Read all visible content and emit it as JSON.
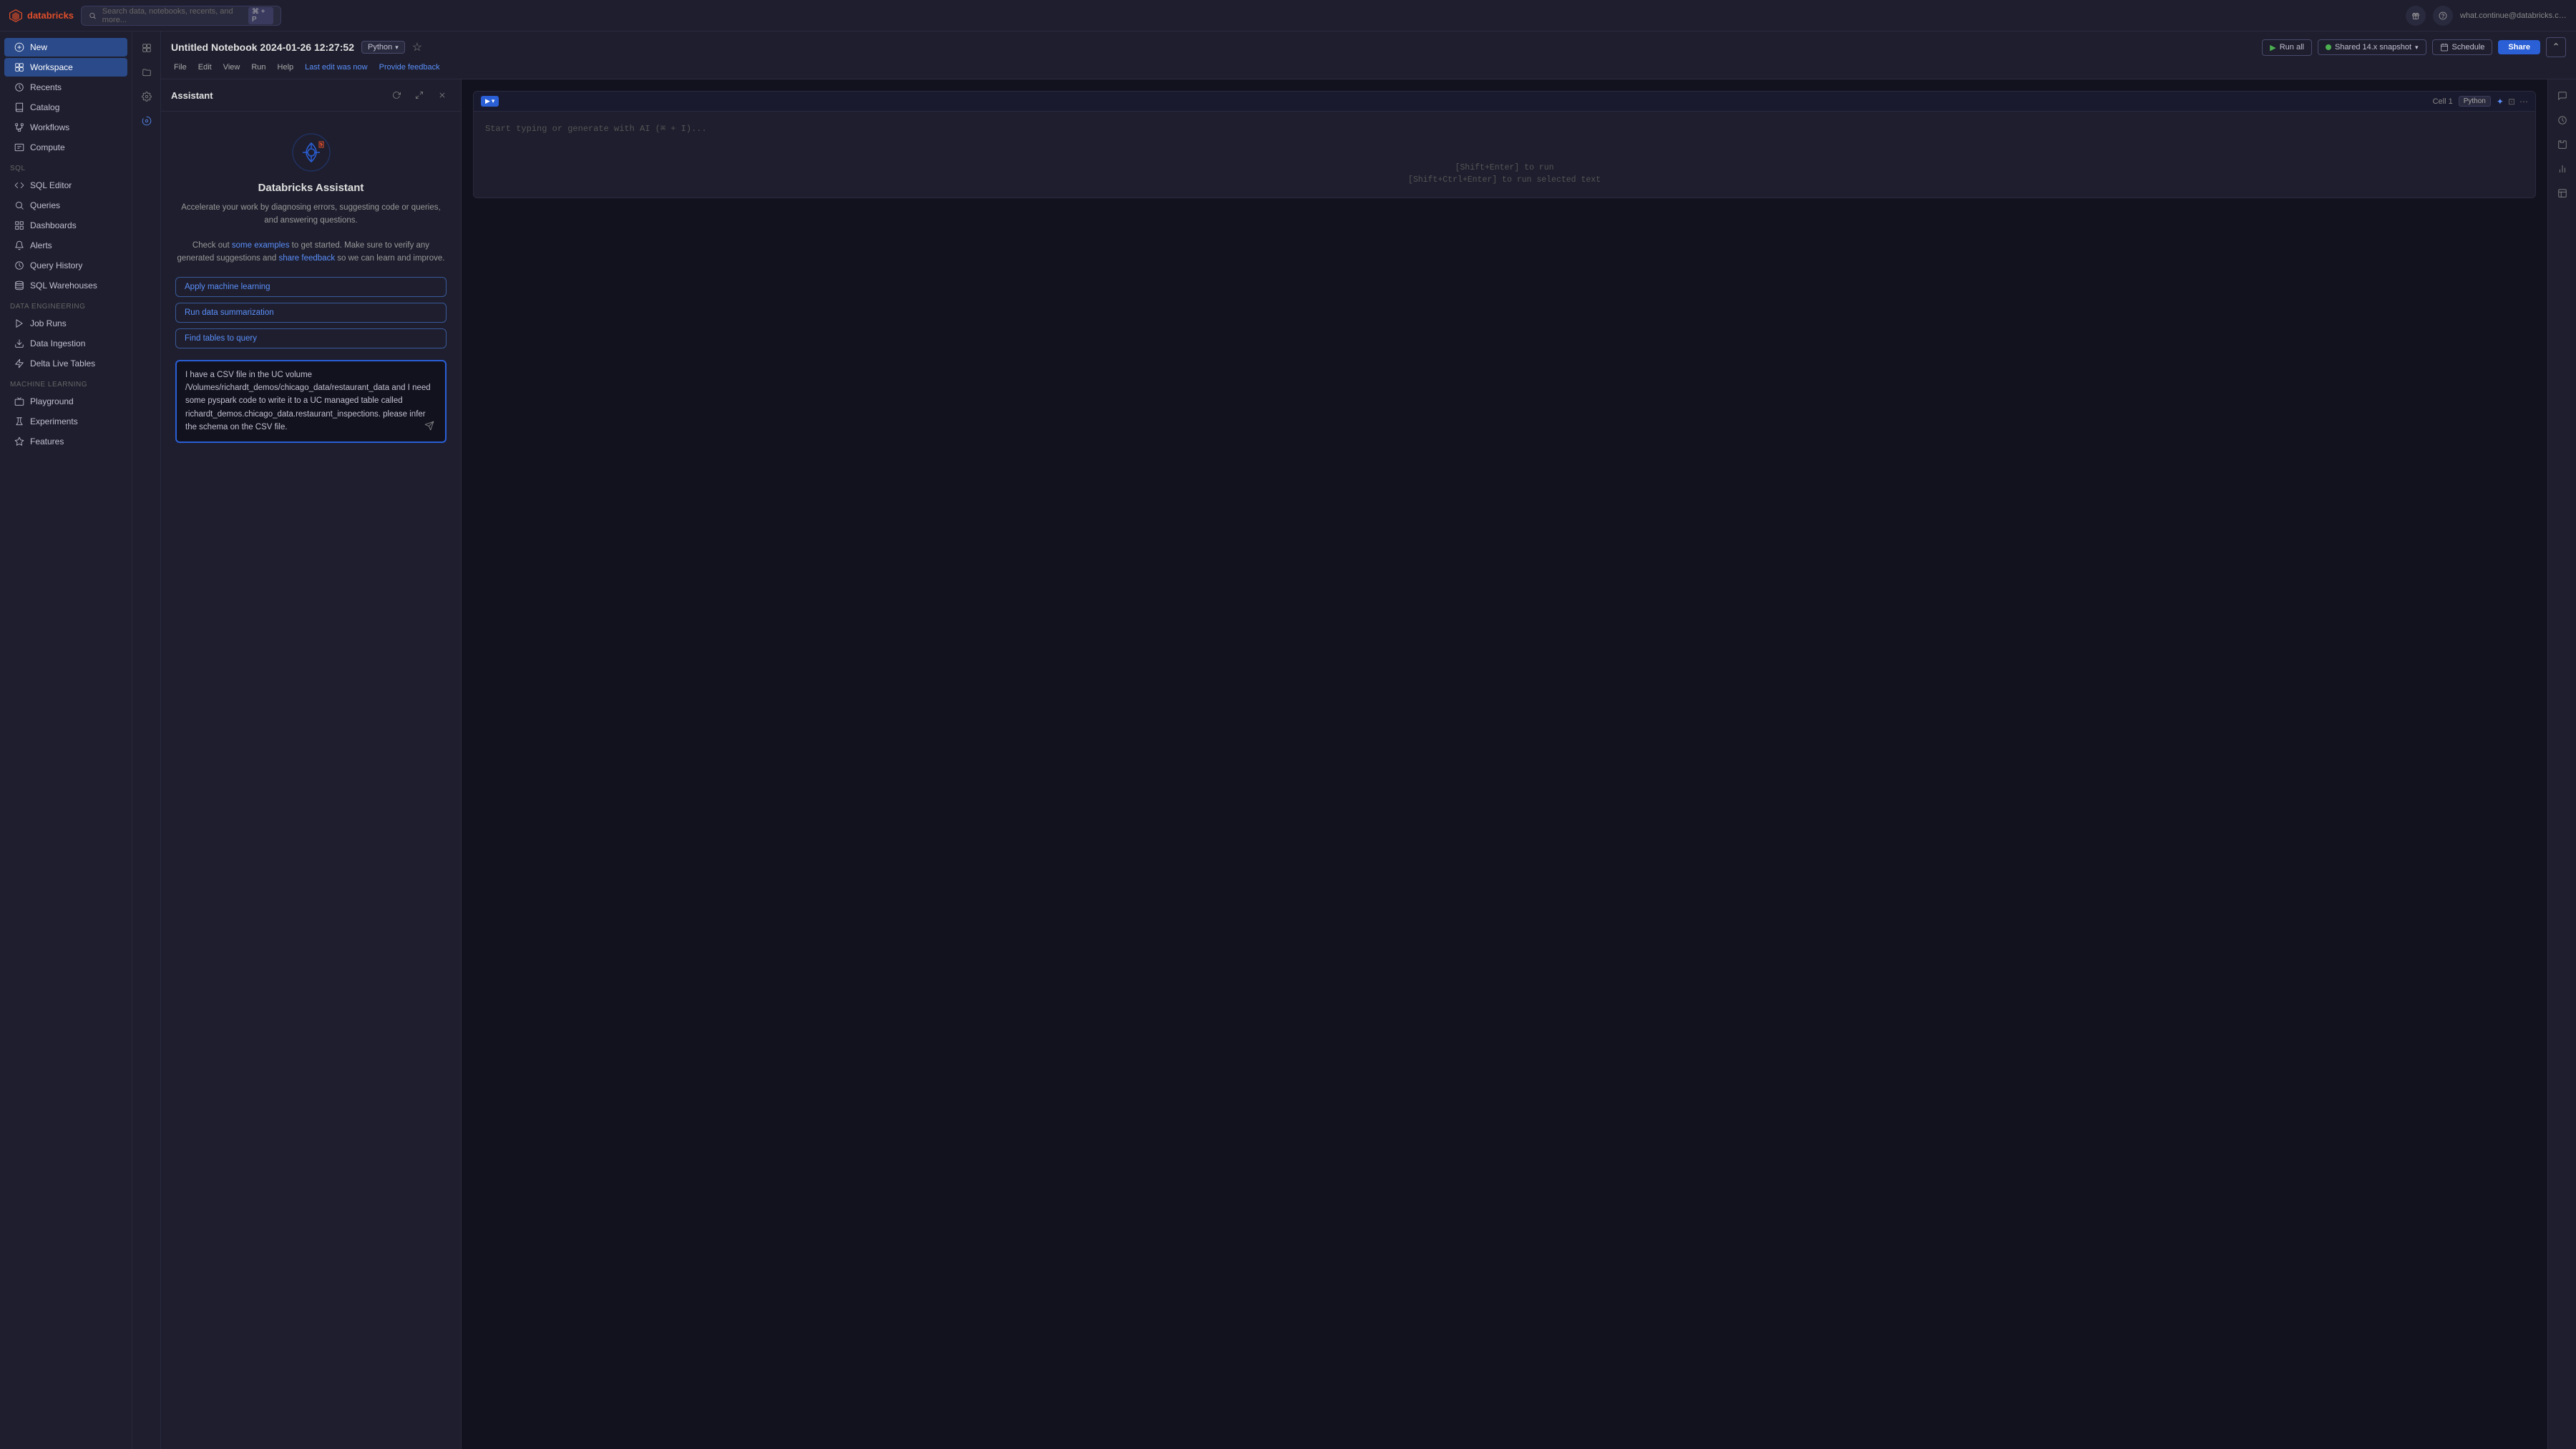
{
  "app": {
    "logo_text": "databricks"
  },
  "topbar": {
    "search_placeholder": "Search data, notebooks, recents, and more...",
    "search_shortcut": "⌘ + P",
    "user_info": "what.continue@databricks.co...."
  },
  "sidebar": {
    "new_label": "New",
    "items": [
      {
        "id": "workspace",
        "label": "Workspace",
        "active": true
      },
      {
        "id": "recents",
        "label": "Recents",
        "active": false
      },
      {
        "id": "catalog",
        "label": "Catalog",
        "active": false
      },
      {
        "id": "workflows",
        "label": "Workflows",
        "active": false
      },
      {
        "id": "compute",
        "label": "Compute",
        "active": false
      }
    ],
    "sql_section": "SQL",
    "sql_items": [
      {
        "id": "sql-editor",
        "label": "SQL Editor"
      },
      {
        "id": "queries",
        "label": "Queries"
      },
      {
        "id": "dashboards",
        "label": "Dashboards"
      },
      {
        "id": "alerts",
        "label": "Alerts"
      },
      {
        "id": "query-history",
        "label": "Query History"
      },
      {
        "id": "sql-warehouses",
        "label": "SQL Warehouses"
      }
    ],
    "data_engineering_section": "Data Engineering",
    "data_engineering_items": [
      {
        "id": "job-runs",
        "label": "Job Runs"
      },
      {
        "id": "data-ingestion",
        "label": "Data Ingestion"
      },
      {
        "id": "delta-live-tables",
        "label": "Delta Live Tables"
      }
    ],
    "ml_section": "Machine Learning",
    "ml_items": [
      {
        "id": "playground",
        "label": "Playground"
      },
      {
        "id": "experiments",
        "label": "Experiments"
      },
      {
        "id": "features",
        "label": "Features"
      }
    ]
  },
  "notebook": {
    "title": "Untitled Notebook 2024-01-26 12:27:52",
    "language": "Python",
    "last_edit": "Last edit was now",
    "provide_feedback": "Provide feedback",
    "menu": [
      "File",
      "Edit",
      "View",
      "Run",
      "Help"
    ],
    "run_all_label": "Run all",
    "shared_label": "Shared 14.x snapshot",
    "schedule_label": "Schedule",
    "share_label": "Share"
  },
  "assistant": {
    "title": "Assistant",
    "heading": "Databricks Assistant",
    "description_1": "Accelerate your work by diagnosing errors, suggesting code or queries, and answering questions.",
    "description_2": "Check out",
    "some_examples_link": "some examples",
    "description_3": "to get started. Make sure to verify any generated suggestions and",
    "share_feedback_link": "share feedback",
    "description_4": "so we can learn and improve.",
    "suggestions": [
      "Apply machine learning",
      "Run data summarization",
      "Find tables to query"
    ],
    "input_text": "I have a CSV file in the UC volume /Volumes/richardt_demos/chicago_data/restaurant_data and I need some pyspark code to write it to a UC managed table called richardt_demos.chicago_data.restaurant_inspections. please infer the schema on the CSV file."
  },
  "cell": {
    "label": "Cell 1",
    "language": "Python",
    "placeholder": "Start typing or generate with AI (⌘ + I)...",
    "hint_1": "[Shift+Enter] to run",
    "hint_2": "[Shift+Ctrl+Enter] to run selected text"
  }
}
